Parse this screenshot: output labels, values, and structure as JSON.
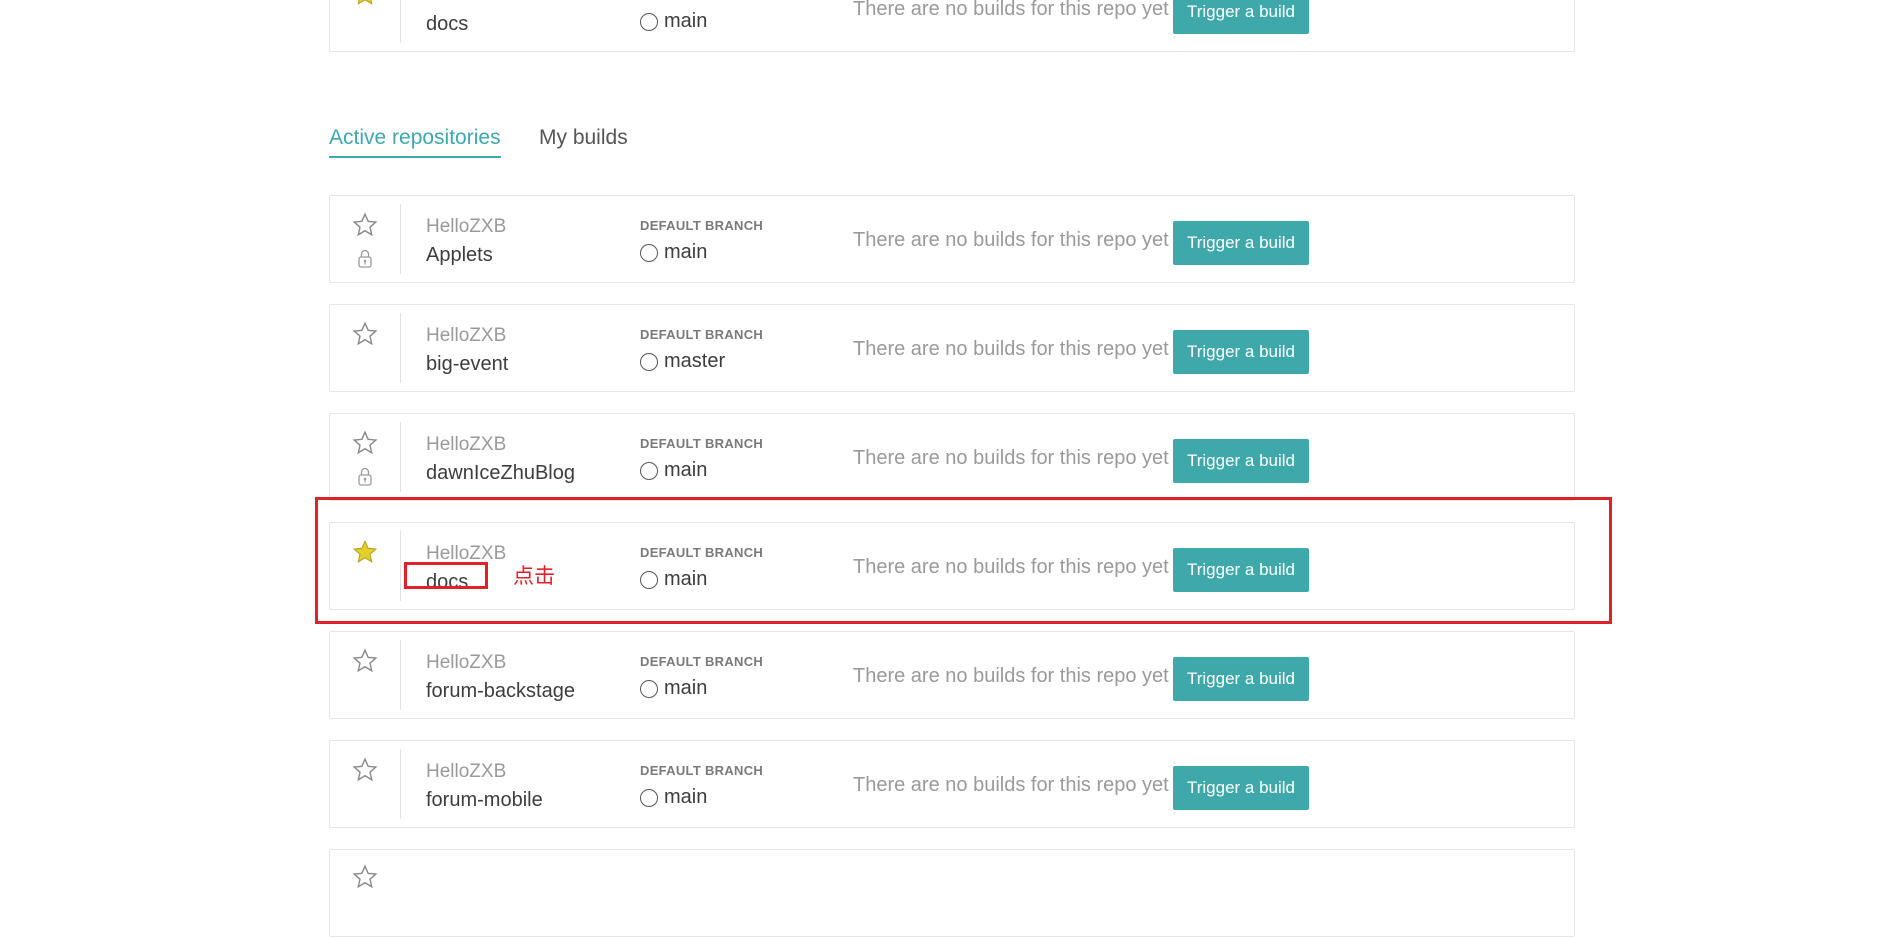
{
  "tabs": [
    {
      "label": "Active repositories",
      "active": true
    },
    {
      "label": "My builds",
      "active": false
    }
  ],
  "common": {
    "branch_label": "DEFAULT BRANCH",
    "no_builds_text": "There are no builds for this repo yet",
    "trigger_label": "Trigger a build"
  },
  "top_partial_row": {
    "name": "docs",
    "branch": "main",
    "starred": true
  },
  "repos": [
    {
      "owner": "HelloZXB",
      "name": "Applets",
      "branch": "main",
      "starred": false,
      "private": true
    },
    {
      "owner": "HelloZXB",
      "name": "big-event",
      "branch": "master",
      "starred": false,
      "private": false
    },
    {
      "owner": "HelloZXB",
      "name": "dawnIceZhuBlog",
      "branch": "main",
      "starred": false,
      "private": true
    },
    {
      "owner": "HelloZXB",
      "name": "docs",
      "branch": "main",
      "starred": true,
      "private": false
    },
    {
      "owner": "HelloZXB",
      "name": "forum-backstage",
      "branch": "main",
      "starred": false,
      "private": false
    },
    {
      "owner": "HelloZXB",
      "name": "forum-mobile",
      "branch": "main",
      "starred": false,
      "private": false
    }
  ],
  "annotation": {
    "text": "点击"
  },
  "colors": {
    "accent": "#3fa8ab",
    "annotation_red": "#e0202a",
    "star_filled": "#e6cf2a",
    "star_outline": "#8a8a8a"
  },
  "icons": {
    "star": "star-icon",
    "lock": "lock-icon",
    "branch": "branch-circle-icon"
  }
}
